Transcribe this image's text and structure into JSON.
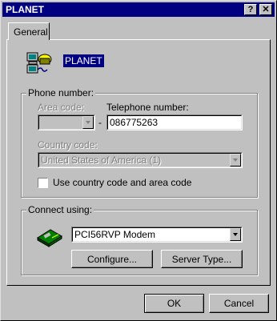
{
  "window": {
    "title": "PLANET",
    "help_glyph": "?",
    "close_glyph": "✕"
  },
  "tabs": [
    {
      "label": "General",
      "active": true
    }
  ],
  "connection": {
    "name": "PLANET",
    "icon": "dialup-connection-icon"
  },
  "phone": {
    "group_label": "Phone number:",
    "area_code_label": "Area code:",
    "area_code_value": "",
    "separator": "-",
    "telephone_label": "Telephone number:",
    "telephone_value": "086775263",
    "country_code_label": "Country code:",
    "country_code_value": "United States of America (1)",
    "use_country_label": "Use country code and area code",
    "use_country_checked": false
  },
  "connect": {
    "group_label": "Connect using:",
    "modem_icon": "modem-icon",
    "modem_value": "PCI56RVP Modem",
    "configure_label": "Configure...",
    "server_type_label": "Server Type..."
  },
  "footer": {
    "ok_label": "OK",
    "cancel_label": "Cancel"
  },
  "colors": {
    "titlebar": "#000080",
    "face": "#c0c0c0",
    "selection": "#000080"
  }
}
